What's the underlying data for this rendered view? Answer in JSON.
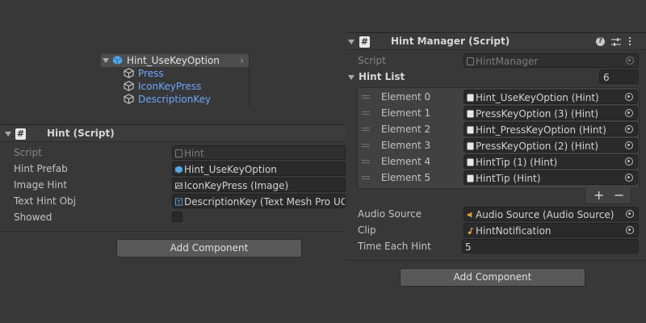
{
  "hierarchy": {
    "selected": "Hint_UseKeyOption",
    "children": [
      "Press",
      "IconKeyPress",
      "DescriptionKey"
    ]
  },
  "hint_component": {
    "title": "Hint (Script)",
    "fields": [
      {
        "label": "Script",
        "value": "Hint",
        "icon": "script-icon"
      },
      {
        "label": "Hint Prefab",
        "value": "Hint_UseKeyOption",
        "icon": "prefab-icon"
      },
      {
        "label": "Image Hint",
        "value": "IconKeyPress (Image)",
        "icon": "image-icon"
      },
      {
        "label": "Text Hint Obj",
        "value": "DescriptionKey (Text Mesh Pro UGU",
        "icon": "text-icon"
      },
      {
        "label": "Showed",
        "checked": false
      }
    ],
    "add_component": "Add Component"
  },
  "hint_manager": {
    "title": "Hint Manager (Script)",
    "script_label": "Script",
    "script_value": "HintManager",
    "list_label": "Hint List",
    "list_size": "6",
    "elements": [
      {
        "label": "Element 0",
        "value": "Hint_UseKeyOption (Hint)"
      },
      {
        "label": "Element 1",
        "value": "PressKeyOption (3) (Hint)"
      },
      {
        "label": "Element 2",
        "value": "Hint_PressKeyOption (Hint)"
      },
      {
        "label": "Element 3",
        "value": "PressKeyOption (2) (Hint)"
      },
      {
        "label": "Element 4",
        "value": "HintTip (1) (Hint)"
      },
      {
        "label": "Element 5",
        "value": "HintTip (Hint)"
      }
    ],
    "add_label": "+",
    "remove_label": "−",
    "audio_source_label": "Audio Source",
    "audio_source_value": "Audio Source (Audio Source)",
    "clip_label": "Clip",
    "clip_value": "HintNotification",
    "time_label": "Time Each Hint",
    "time_value": "5",
    "add_component": "Add Component",
    "header_icons": [
      "help-icon",
      "settings-sliders-icon",
      "kebab-menu-icon"
    ]
  },
  "colors": {
    "background": "#383838",
    "field": "#2a2a2a",
    "link": "#6ca7ff"
  }
}
